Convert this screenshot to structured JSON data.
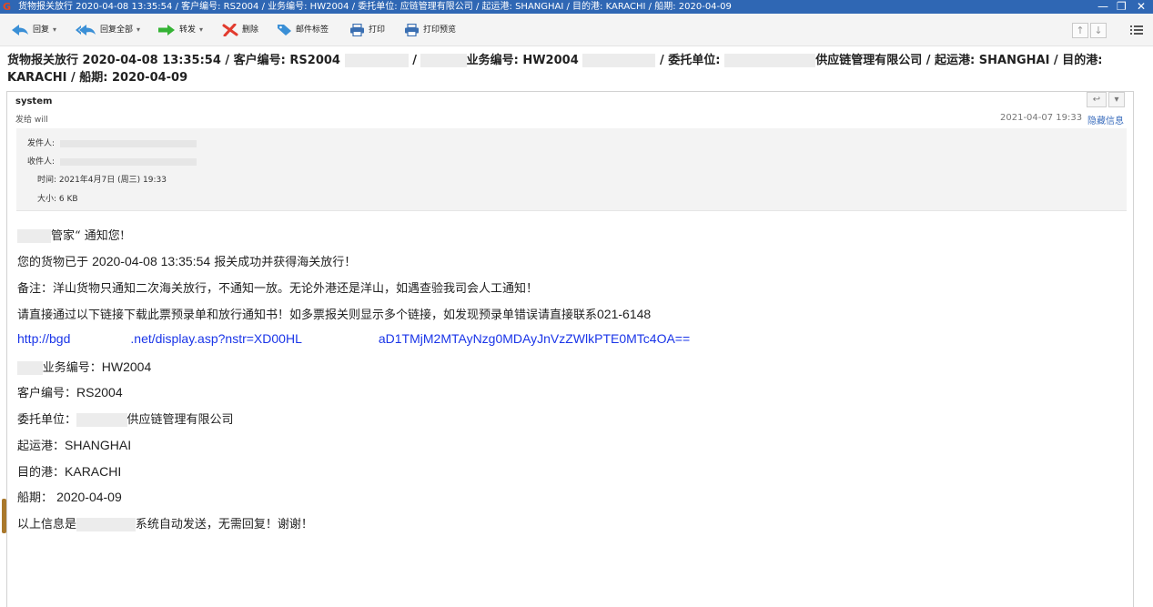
{
  "window": {
    "title": "货物报关放行 2020-04-08 13:35:54 / 客户编号: RS2004     /     业务编号: HW2004      / 委托单位:         应链管理有限公司 / 起运港: SHANGHAI / 目的港: KARACHI / 船期: 2020-04-09",
    "minimize": "—",
    "maximize": "❐",
    "close": "✕"
  },
  "toolbar": {
    "reply": "回复",
    "reply_all": "回复全部",
    "forward": "转发",
    "delete": "删除",
    "tag": "邮件标签",
    "print": "打印",
    "print_preview": "打印预览",
    "arrow": "▾",
    "prev": "↑",
    "next": "↓"
  },
  "subject": {
    "part1": "货物报关放行 2020-04-08 13:35:54 / 客户编号: RS2004",
    "part2": "/",
    "part3": "业务编号: HW2004",
    "part4": "/ 委托单位:",
    "part5": "供应链管理有限公司 / 起运港: SHANGHAI / 目的港: KARACHI / 船期: 2020-04-09"
  },
  "message": {
    "sender": "system",
    "recipient": "发给 will",
    "date": "2021-04-07 19:33",
    "hide_details": "隐藏信息",
    "reply_icon": "↩",
    "more_icon": "▾",
    "details": {
      "from_label": "发件人:",
      "to_label": "收件人:",
      "time_label": "时间: 2021年4月7日 (周三) 19:33",
      "size_label": "大小: 6 KB"
    },
    "body": {
      "greeting": "管家“ 通知您!",
      "line1_pre": "您的货物已于 ",
      "line1_time": "2020-04-08 13:35:54",
      "line1_post": " 报关成功并获得海关放行！",
      "line2": "备注：洋山货物只通知二次海关放行，不通知一放。无论外港还是洋山，如遇查验我司会人工通知！",
      "line3_pre": "请直接通过以下链接下载此票预录单和放行通知书！如多票报关则显示多个链接，如发现预录单错误请直接联系",
      "line3_phone": "021-6148",
      "link_part1": "http://bgd",
      "link_part2": ".net/display.asp?nstr=XD00HL",
      "link_part3": "aD1TMjM2MTAyNzg0MDAyJnVzZWlkPTE0MTc4OA==",
      "biz_label": "业务编号：",
      "biz_value": "HW2004",
      "cust_label": "客户编号：",
      "cust_value": "RS2004",
      "client_label": "委托单位：",
      "client_value": "供应链管理有限公司",
      "origin_label": "起运港：",
      "origin_value": "SHANGHAI",
      "dest_label": "目的港：",
      "dest_value": "KARACHI",
      "sail_label": "船期： ",
      "sail_value": "2020-04-09",
      "closing_pre": "以上信息是",
      "closing_post": "系统自动发送，无需回复！谢谢！"
    }
  },
  "colors": {
    "titlebar": "#2f67b4",
    "link": "#1a35e8",
    "accent_link": "#3d6fbe"
  }
}
